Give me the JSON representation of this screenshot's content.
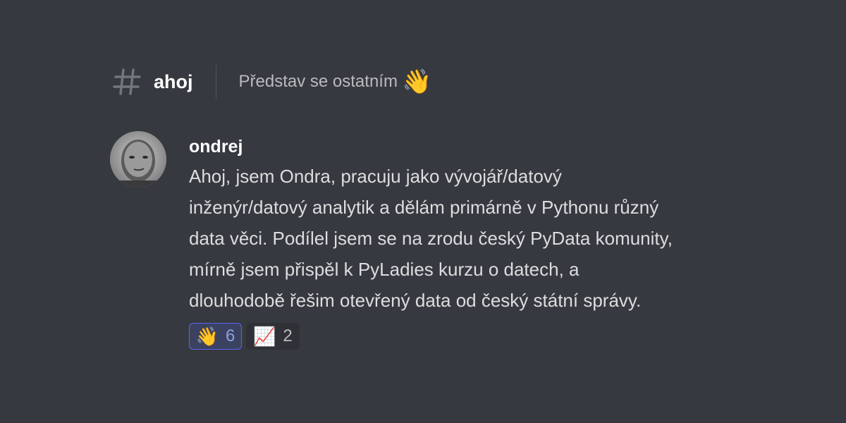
{
  "channel": {
    "name": "ahoj",
    "topic": "Představ se ostatním",
    "topic_emoji": "👋",
    "hash_icon": "hash-icon"
  },
  "message": {
    "author": "ondrej",
    "avatar_icon": "user-avatar",
    "lines": [
      "Ahoj, jsem Ondra, pracuju jako vývojář/datový",
      "inženýr/datový analytik a dělám primárně v Pythonu různý",
      "data věci. Podílel jsem se na zrodu český PyData komunity,",
      "mírně jsem přispěl k PyLadies kurzu o datech, a",
      "dlouhodobě řešim otevřený data od český státní správy."
    ],
    "reactions": [
      {
        "emoji": "👋",
        "count": "6",
        "active": true
      },
      {
        "emoji": "📈",
        "count": "2",
        "active": false
      }
    ]
  },
  "colors": {
    "background": "#36393f",
    "text": "#dcddde",
    "muted": "#b9bbbe",
    "accent": "#5865f2"
  }
}
